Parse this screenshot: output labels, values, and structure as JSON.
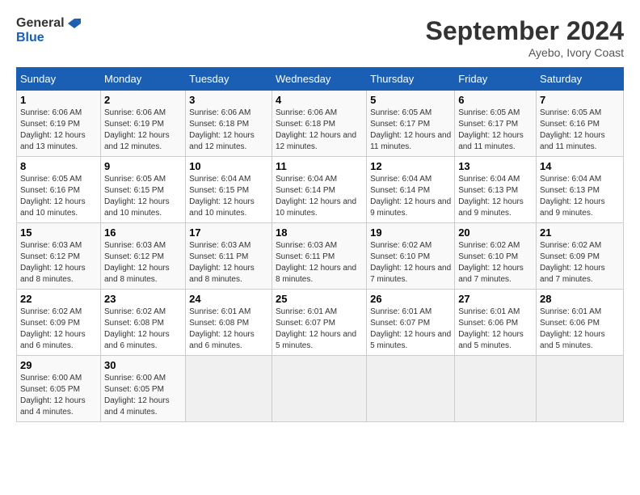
{
  "logo": {
    "line1": "General",
    "line2": "Blue"
  },
  "title": "September 2024",
  "location": "Ayebo, Ivory Coast",
  "weekdays": [
    "Sunday",
    "Monday",
    "Tuesday",
    "Wednesday",
    "Thursday",
    "Friday",
    "Saturday"
  ],
  "weeks": [
    [
      {
        "day": "1",
        "sunrise": "6:06 AM",
        "sunset": "6:19 PM",
        "daylight": "12 hours and 13 minutes."
      },
      {
        "day": "2",
        "sunrise": "6:06 AM",
        "sunset": "6:19 PM",
        "daylight": "12 hours and 12 minutes."
      },
      {
        "day": "3",
        "sunrise": "6:06 AM",
        "sunset": "6:18 PM",
        "daylight": "12 hours and 12 minutes."
      },
      {
        "day": "4",
        "sunrise": "6:06 AM",
        "sunset": "6:18 PM",
        "daylight": "12 hours and 12 minutes."
      },
      {
        "day": "5",
        "sunrise": "6:05 AM",
        "sunset": "6:17 PM",
        "daylight": "12 hours and 11 minutes."
      },
      {
        "day": "6",
        "sunrise": "6:05 AM",
        "sunset": "6:17 PM",
        "daylight": "12 hours and 11 minutes."
      },
      {
        "day": "7",
        "sunrise": "6:05 AM",
        "sunset": "6:16 PM",
        "daylight": "12 hours and 11 minutes."
      }
    ],
    [
      {
        "day": "8",
        "sunrise": "6:05 AM",
        "sunset": "6:16 PM",
        "daylight": "12 hours and 10 minutes."
      },
      {
        "day": "9",
        "sunrise": "6:05 AM",
        "sunset": "6:15 PM",
        "daylight": "12 hours and 10 minutes."
      },
      {
        "day": "10",
        "sunrise": "6:04 AM",
        "sunset": "6:15 PM",
        "daylight": "12 hours and 10 minutes."
      },
      {
        "day": "11",
        "sunrise": "6:04 AM",
        "sunset": "6:14 PM",
        "daylight": "12 hours and 10 minutes."
      },
      {
        "day": "12",
        "sunrise": "6:04 AM",
        "sunset": "6:14 PM",
        "daylight": "12 hours and 9 minutes."
      },
      {
        "day": "13",
        "sunrise": "6:04 AM",
        "sunset": "6:13 PM",
        "daylight": "12 hours and 9 minutes."
      },
      {
        "day": "14",
        "sunrise": "6:04 AM",
        "sunset": "6:13 PM",
        "daylight": "12 hours and 9 minutes."
      }
    ],
    [
      {
        "day": "15",
        "sunrise": "6:03 AM",
        "sunset": "6:12 PM",
        "daylight": "12 hours and 8 minutes."
      },
      {
        "day": "16",
        "sunrise": "6:03 AM",
        "sunset": "6:12 PM",
        "daylight": "12 hours and 8 minutes."
      },
      {
        "day": "17",
        "sunrise": "6:03 AM",
        "sunset": "6:11 PM",
        "daylight": "12 hours and 8 minutes."
      },
      {
        "day": "18",
        "sunrise": "6:03 AM",
        "sunset": "6:11 PM",
        "daylight": "12 hours and 8 minutes."
      },
      {
        "day": "19",
        "sunrise": "6:02 AM",
        "sunset": "6:10 PM",
        "daylight": "12 hours and 7 minutes."
      },
      {
        "day": "20",
        "sunrise": "6:02 AM",
        "sunset": "6:10 PM",
        "daylight": "12 hours and 7 minutes."
      },
      {
        "day": "21",
        "sunrise": "6:02 AM",
        "sunset": "6:09 PM",
        "daylight": "12 hours and 7 minutes."
      }
    ],
    [
      {
        "day": "22",
        "sunrise": "6:02 AM",
        "sunset": "6:09 PM",
        "daylight": "12 hours and 6 minutes."
      },
      {
        "day": "23",
        "sunrise": "6:02 AM",
        "sunset": "6:08 PM",
        "daylight": "12 hours and 6 minutes."
      },
      {
        "day": "24",
        "sunrise": "6:01 AM",
        "sunset": "6:08 PM",
        "daylight": "12 hours and 6 minutes."
      },
      {
        "day": "25",
        "sunrise": "6:01 AM",
        "sunset": "6:07 PM",
        "daylight": "12 hours and 5 minutes."
      },
      {
        "day": "26",
        "sunrise": "6:01 AM",
        "sunset": "6:07 PM",
        "daylight": "12 hours and 5 minutes."
      },
      {
        "day": "27",
        "sunrise": "6:01 AM",
        "sunset": "6:06 PM",
        "daylight": "12 hours and 5 minutes."
      },
      {
        "day": "28",
        "sunrise": "6:01 AM",
        "sunset": "6:06 PM",
        "daylight": "12 hours and 5 minutes."
      }
    ],
    [
      {
        "day": "29",
        "sunrise": "6:00 AM",
        "sunset": "6:05 PM",
        "daylight": "12 hours and 4 minutes."
      },
      {
        "day": "30",
        "sunrise": "6:00 AM",
        "sunset": "6:05 PM",
        "daylight": "12 hours and 4 minutes."
      },
      null,
      null,
      null,
      null,
      null
    ]
  ]
}
